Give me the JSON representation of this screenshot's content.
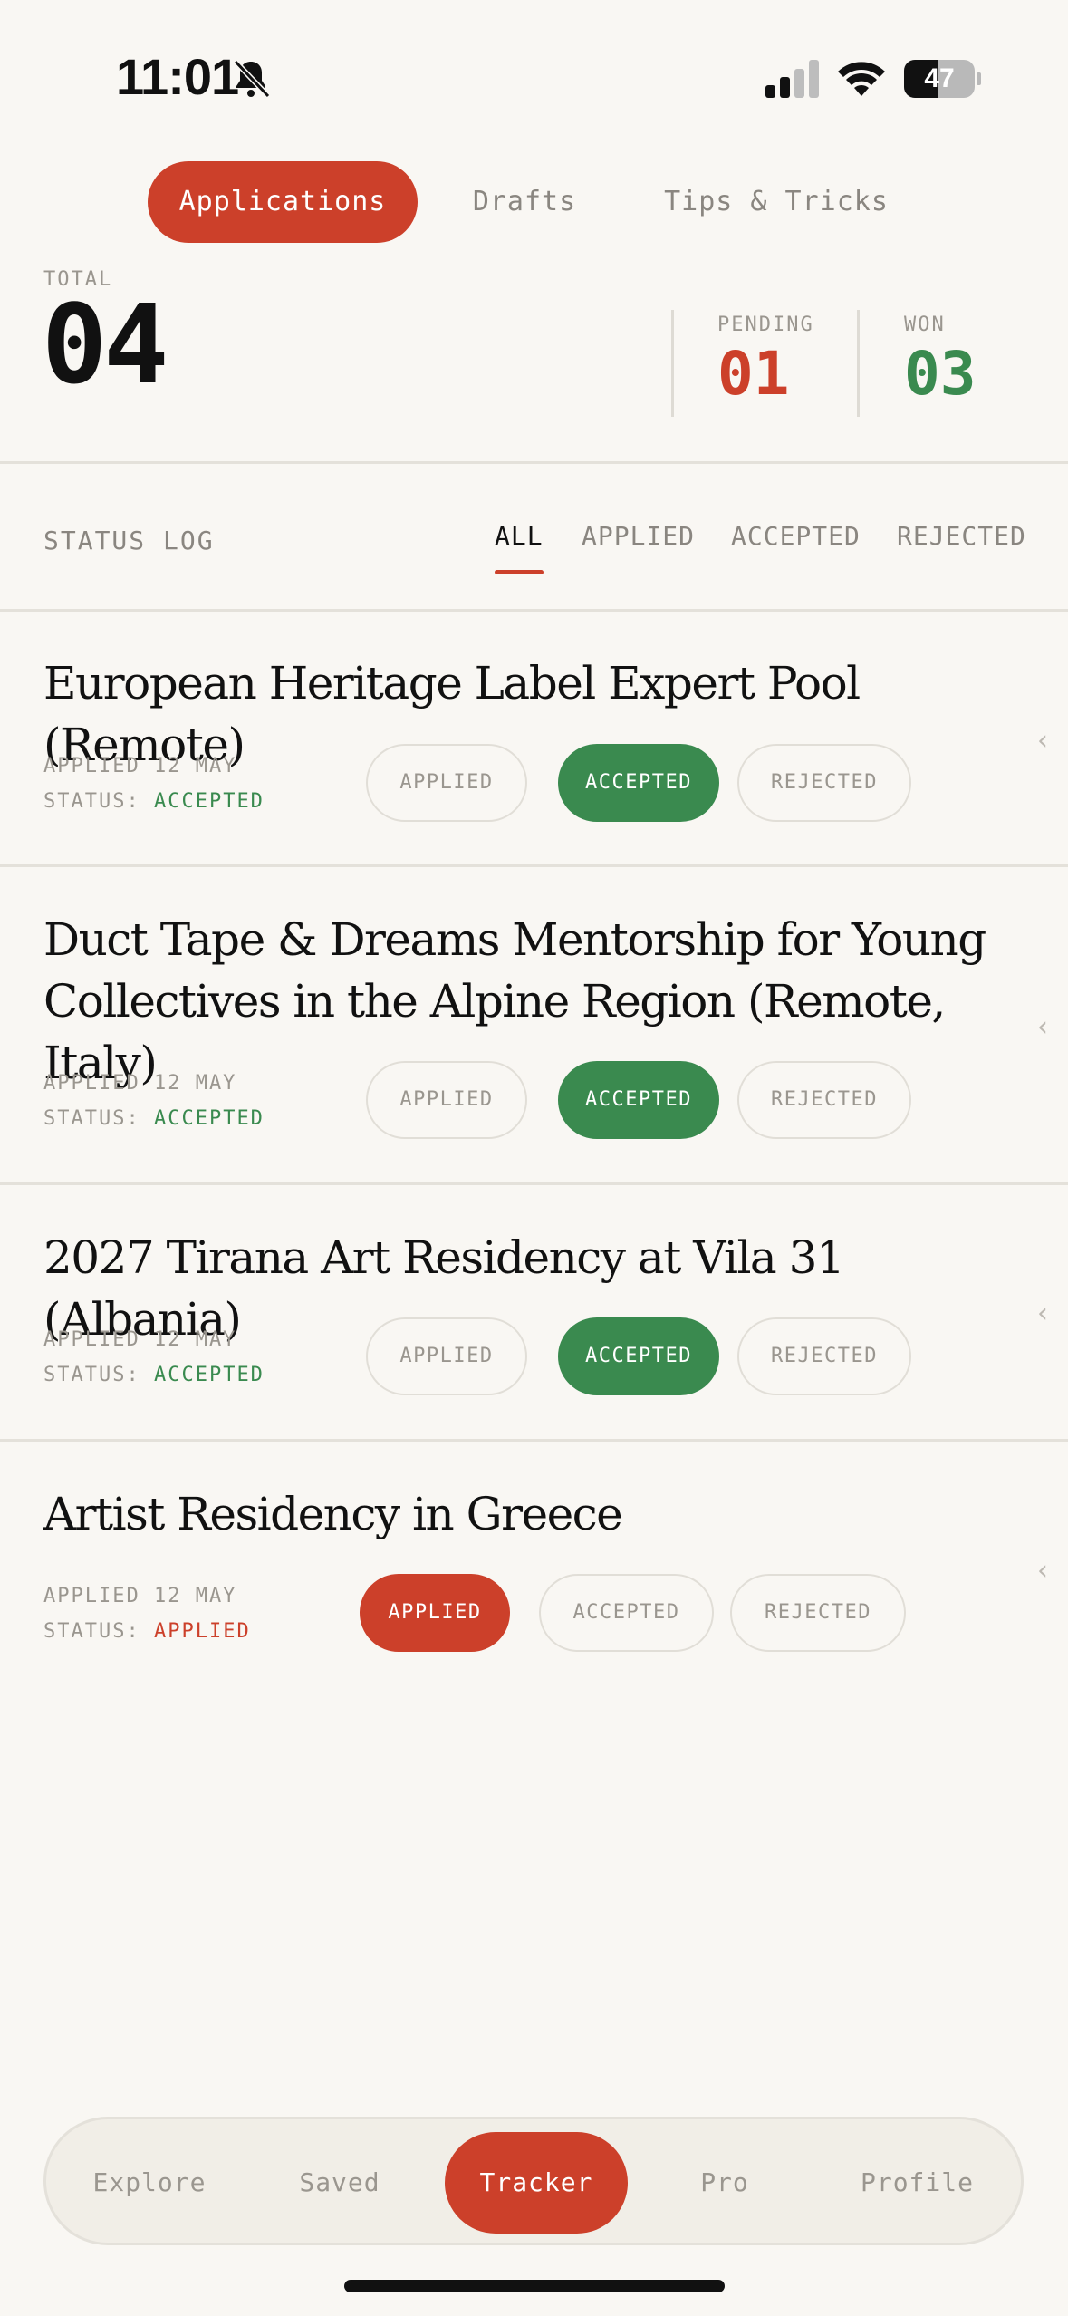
{
  "status_bar": {
    "time": "11:01",
    "battery": "47"
  },
  "top_tabs": [
    {
      "label": "Applications",
      "active": true
    },
    {
      "label": "Drafts",
      "active": false
    },
    {
      "label": "Tips & Tricks",
      "active": false
    }
  ],
  "stats": {
    "total_label": "TOTAL",
    "total": "04",
    "pending_label": "PENDING",
    "pending": "01",
    "won_label": "WON",
    "won": "03"
  },
  "filter_bar": {
    "title": "STATUS LOG",
    "filters": [
      "ALL",
      "APPLIED",
      "ACCEPTED",
      "REJECTED"
    ],
    "active": "ALL"
  },
  "applications": [
    {
      "title": "European Heritage Label Expert Pool (Remote)",
      "applied": "APPLIED 12 MAY",
      "status_label": "STATUS:",
      "status": "ACCEPTED",
      "buttons": [
        "APPLIED",
        "ACCEPTED",
        "REJECTED"
      ]
    },
    {
      "title": "Duct Tape & Dreams Mentorship for Young Collectives in the Alpine Region (Remote, Italy)",
      "applied": "APPLIED 12 MAY",
      "status_label": "STATUS:",
      "status": "ACCEPTED",
      "buttons": [
        "APPLIED",
        "ACCEPTED",
        "REJECTED"
      ]
    },
    {
      "title": "2027 Tirana Art Residency at Vila 31 (Albania)",
      "applied": "APPLIED 12 MAY",
      "status_label": "STATUS:",
      "status": "ACCEPTED",
      "buttons": [
        "APPLIED",
        "ACCEPTED",
        "REJECTED"
      ]
    },
    {
      "title": "Artist Residency in Greece",
      "applied": "APPLIED 12 MAY",
      "status_label": "STATUS:",
      "status": "APPLIED",
      "buttons": [
        "APPLIED",
        "ACCEPTED",
        "REJECTED"
      ]
    }
  ],
  "chevron": "‹",
  "bottom_nav": [
    {
      "label": "Explore",
      "active": false
    },
    {
      "label": "Saved",
      "active": false
    },
    {
      "label": "Tracker",
      "active": true
    },
    {
      "label": "Pro",
      "active": false
    },
    {
      "label": "Profile",
      "active": false
    }
  ],
  "colors": {
    "accent_red": "#cc402a",
    "accent_green": "#3a8a4f",
    "background": "#f9f7f3"
  }
}
